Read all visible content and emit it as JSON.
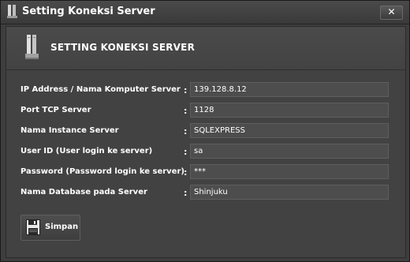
{
  "window": {
    "title": "Setting Koneksi Server",
    "close_glyph": "✕"
  },
  "header": {
    "title": "SETTING KONEKSI SERVER",
    "icon": "server-icon"
  },
  "form": {
    "fields": [
      {
        "label": "IP Address / Nama Komputer Server",
        "value": "139.128.8.12"
      },
      {
        "label": "Port TCP Server",
        "value": "1128"
      },
      {
        "label": "Nama Instance Server",
        "value": "SQLEXPRESS"
      },
      {
        "label": "User ID (User login ke server)",
        "value": "sa"
      },
      {
        "label": "Password (Password login ke server)",
        "value": "***"
      },
      {
        "label": "Nama Database pada Server",
        "value": "Shinjuku"
      }
    ],
    "separator": ":"
  },
  "save_button": {
    "label": "Simpan",
    "icon": "floppy-disk-icon"
  }
}
